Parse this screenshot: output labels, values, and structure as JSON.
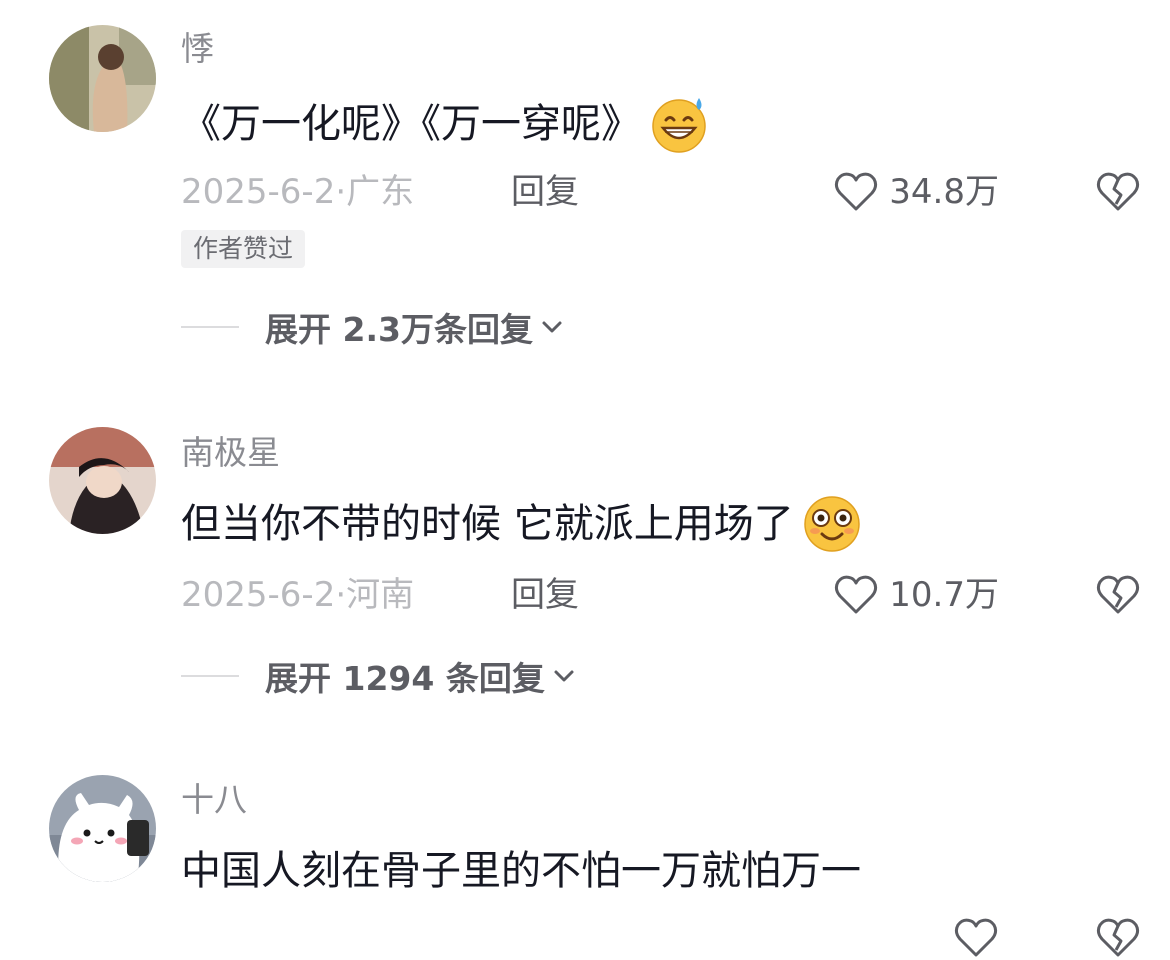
{
  "comments": [
    {
      "username": "悸",
      "content": "《万一化呢》《万一穿呢》",
      "emoji": "grinning-sweat-emoji",
      "date_location": "2025-6-2·广东",
      "reply_label": "回复",
      "like_count": "34.8万",
      "author_liked": "作者赞过",
      "expand_label": "展开 2.3万条回复"
    },
    {
      "username": "南极星",
      "content": "但当你不带的时候 它就派上用场了",
      "emoji": "flushed-smile-emoji",
      "date_location": "2025-6-2·河南",
      "reply_label": "回复",
      "like_count": "10.7万",
      "expand_label": "展开 1294 条回复"
    },
    {
      "username": "十八",
      "content": "中国人刻在骨子里的不怕一万就怕万一"
    }
  ],
  "colors": {
    "username": "#8a8b91",
    "date": "#b8b9bd",
    "action": "#5c5d63",
    "text": "#161823"
  }
}
